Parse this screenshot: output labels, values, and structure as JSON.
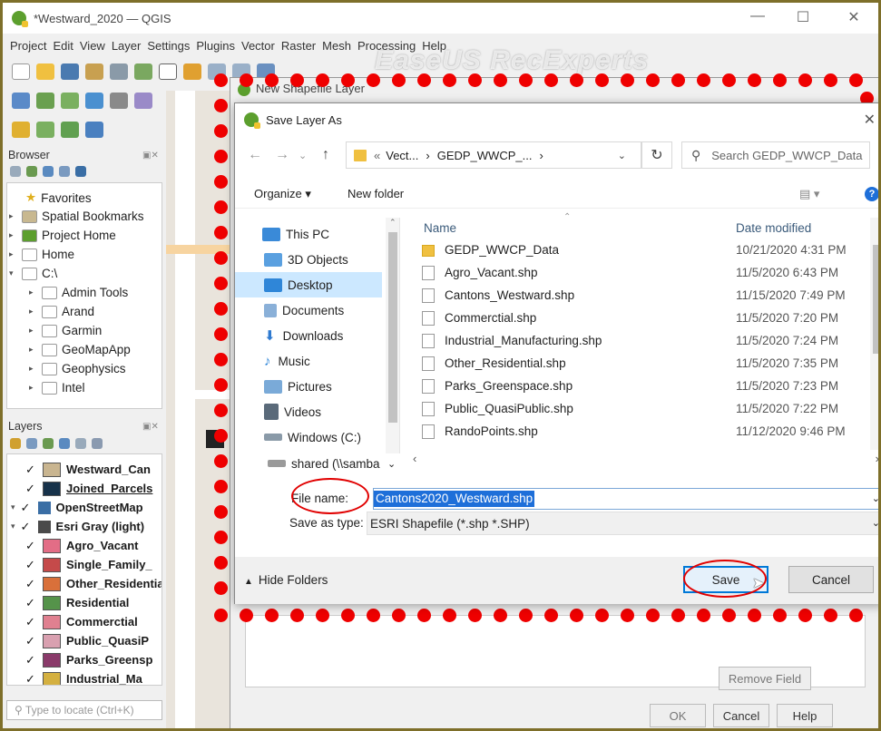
{
  "window": {
    "title": "*Westward_2020 — QGIS"
  },
  "menu": [
    "Project",
    "Edit",
    "View",
    "Layer",
    "Settings",
    "Plugins",
    "Vector",
    "Raster",
    "Mesh",
    "Processing",
    "Help"
  ],
  "watermark": "EaseUS RecExperts",
  "browser": {
    "title": "Browser",
    "items": [
      {
        "label": "Favorites",
        "arrow": ""
      },
      {
        "label": "Spatial Bookmarks",
        "arrow": "▸"
      },
      {
        "label": "Project Home",
        "arrow": "▸"
      },
      {
        "label": "Home",
        "arrow": "▸"
      },
      {
        "label": "C:\\",
        "arrow": "▾"
      },
      {
        "label": "Admin Tools",
        "arrow": "▸"
      },
      {
        "label": "Arand",
        "arrow": "▸"
      },
      {
        "label": "Garmin",
        "arrow": "▸"
      },
      {
        "label": "GeoMapApp",
        "arrow": "▸"
      },
      {
        "label": "Geophysics",
        "arrow": "▸"
      },
      {
        "label": "Intel",
        "arrow": "▸"
      }
    ]
  },
  "layers": {
    "title": "Layers",
    "items": [
      {
        "label": "Westward_Can",
        "color": "#c9b590",
        "check": "✓"
      },
      {
        "label": "Joined_Parcels",
        "color": "#17324a",
        "check": "✓"
      },
      {
        "label": "OpenStreetMap",
        "color": "#3a6ea5",
        "check": "✓"
      },
      {
        "label": "Esri Gray (light)",
        "color": "#4a4a4a",
        "check": "✓"
      },
      {
        "label": "Agro_Vacant",
        "color": "#e36d86",
        "check": "✓"
      },
      {
        "label": "Single_Family_",
        "color": "#c54a4a",
        "check": "✓"
      },
      {
        "label": "Other_Residential",
        "color": "#d9703a",
        "check": "✓"
      },
      {
        "label": "Residential",
        "color": "#55934a",
        "check": "✓"
      },
      {
        "label": "Commerctial",
        "color": "#e08090",
        "check": "✓"
      },
      {
        "label": "Public_QuasiP",
        "color": "#d9a0b0",
        "check": "✓"
      },
      {
        "label": "Parks_Greensp",
        "color": "#8a3a6a",
        "check": "✓"
      },
      {
        "label": "Industrial_Ma",
        "color": "#d4b040",
        "check": "✓"
      }
    ],
    "locate_placeholder": "Type to locate (Ctrl+K)"
  },
  "bg_dialog": {
    "title": "New Shapefile Layer",
    "remove_field": "Remove Field",
    "ok": "OK",
    "cancel": "Cancel",
    "help": "Help"
  },
  "save_dialog": {
    "title": "Save Layer As",
    "breadcrumb": [
      "«",
      "Vect...",
      "›",
      "GEDP_WWCP_...",
      "›"
    ],
    "search_placeholder": "Search GEDP_WWCP_Data",
    "organize": "Organize ▾",
    "new_folder": "New folder",
    "nav": [
      {
        "label": "This PC",
        "color": "#3a8ad8"
      },
      {
        "label": "3D Objects",
        "color": "#5aa0e0"
      },
      {
        "label": "Desktop",
        "color": "#2f86d8"
      },
      {
        "label": "Documents",
        "color": "#8ab0d8"
      },
      {
        "label": "Downloads",
        "color": "#2f7ad0"
      },
      {
        "label": "Music",
        "color": "#2f86d8"
      },
      {
        "label": "Pictures",
        "color": "#7aaad8"
      },
      {
        "label": "Videos",
        "color": "#5a6a7a"
      },
      {
        "label": "Windows (C:)",
        "color": "#8a9aa8"
      },
      {
        "label": "shared (\\\\samba",
        "color": "#9a9a9a"
      }
    ],
    "columns": {
      "name": "Name",
      "date": "Date modified"
    },
    "files": [
      {
        "name": "GEDP_WWCP_Data",
        "date": "10/21/2020 4:31 PM",
        "folder": true
      },
      {
        "name": "Agro_Vacant.shp",
        "date": "11/5/2020 6:43 PM",
        "folder": false
      },
      {
        "name": "Cantons_Westward.shp",
        "date": "11/15/2020 7:49 PM",
        "folder": false
      },
      {
        "name": "Commerctial.shp",
        "date": "11/5/2020 7:20 PM",
        "folder": false
      },
      {
        "name": "Industrial_Manufacturing.shp",
        "date": "11/5/2020 7:24 PM",
        "folder": false
      },
      {
        "name": "Other_Residential.shp",
        "date": "11/5/2020 7:35 PM",
        "folder": false
      },
      {
        "name": "Parks_Greenspace.shp",
        "date": "11/5/2020 7:23 PM",
        "folder": false
      },
      {
        "name": "Public_QuasiPublic.shp",
        "date": "11/5/2020 7:22 PM",
        "folder": false
      },
      {
        "name": "RandoPoints.shp",
        "date": "11/12/2020 9:46 PM",
        "folder": false
      }
    ],
    "file_name_label": "File name:",
    "file_name_value": "Cantons2020_Westward.shp",
    "save_type_label": "Save as type:",
    "save_type_value": "ESRI Shapefile (*.shp *.SHP)",
    "hide_folders": "Hide Folders",
    "save": "Save",
    "cancel": "Cancel"
  },
  "colors": {
    "accent": "#0078d7",
    "highlight": "#e10000",
    "selection": "#1e6fd9"
  }
}
